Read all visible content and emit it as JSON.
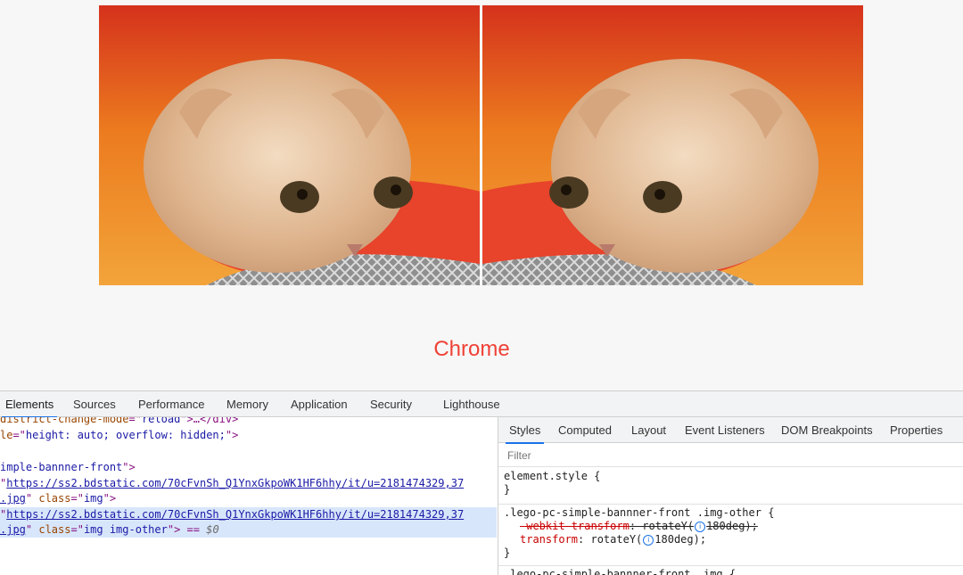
{
  "page": {
    "caption": "Chrome"
  },
  "devtools": {
    "tabs": [
      "Elements",
      "Sources",
      "Performance",
      "Memory",
      "Application",
      "Security",
      "Lighthouse"
    ],
    "elements_lines": [
      {
        "a": "district-change-mode",
        "b": "=\"",
        "c": "reload",
        "d": "\">…</div>"
      },
      {
        "a": "le",
        "b": "=\"",
        "c": "height: auto; overflow: hidden;",
        "d": "\">"
      },
      {
        "a": "",
        "b": "",
        "c": "",
        "d": ""
      },
      {
        "a": "imple-bannner-front",
        "b": "",
        "c": "",
        "d": "\">"
      },
      {
        "pre": "\"",
        "link": "https://ss2.bdstatic.com/70cFvnSh_Q1YnxGkpoWK1HF6hhy/it/u=2181474329,37"
      },
      {
        "link": ".jpg",
        "post1": "\" ",
        "attr": "class",
        "eq": "=\"",
        "val": "img",
        "post2": "\">"
      },
      {
        "pre": "\"",
        "link": "https://ss2.bdstatic.com/70cFvnSh_Q1YnxGkpoWK1HF6hhy/it/u=2181474329,37"
      },
      {
        "link": ".jpg",
        "post1": "\" ",
        "attr": "class",
        "eq": "=\"",
        "val": "img img-other",
        "post2": "\"> == ",
        "meta": "$0"
      }
    ],
    "styles": {
      "subtabs": [
        "Styles",
        "Computed",
        "Layout",
        "Event Listeners",
        "DOM Breakpoints",
        "Properties"
      ],
      "filter_placeholder": "Filter",
      "rule1_selector": "element.style {",
      "rule1_close": "}",
      "rule2_selector": ".lego-pc-simple-bannner-front .img-other {",
      "rule2_prop1_name": "-webkit-transform",
      "rule2_prop1_value_a": ": rotateY(",
      "rule2_prop1_value_b": "180deg);",
      "rule2_prop2_name": "transform",
      "rule2_prop2_value_a": ": rotateY(",
      "rule2_prop2_value_b": "180deg);",
      "rule2_close": "}",
      "rule3_selector": ".lego-pc-simple-bannner-front .img {",
      "info_glyph": "i"
    }
  },
  "colors": {
    "caption": "#ef4136",
    "selection": "#d8e6fb",
    "accent": "#1a73e8"
  }
}
